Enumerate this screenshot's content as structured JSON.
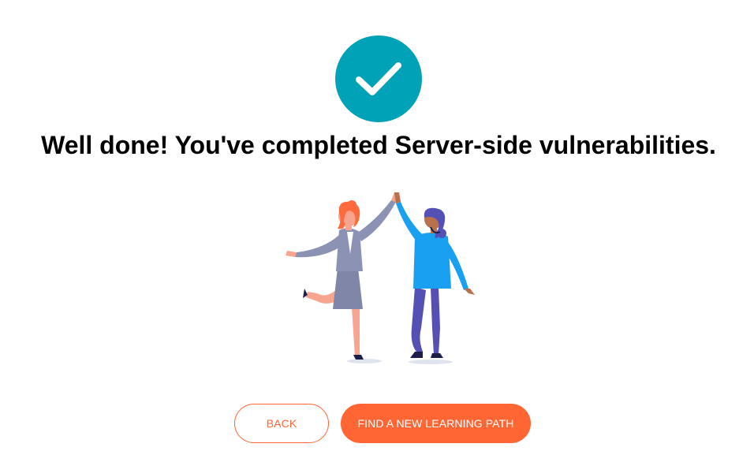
{
  "completion": {
    "headline": "Well done! You've completed Server-side vulnerabilities.",
    "icon": "check-icon",
    "accent_color": "#00a2b7"
  },
  "illustration": {
    "icon": "high-five-illustration"
  },
  "actions": {
    "back_label": "BACK",
    "find_path_label": "FIND A NEW LEARNING PATH",
    "button_color": "#ff6633"
  }
}
